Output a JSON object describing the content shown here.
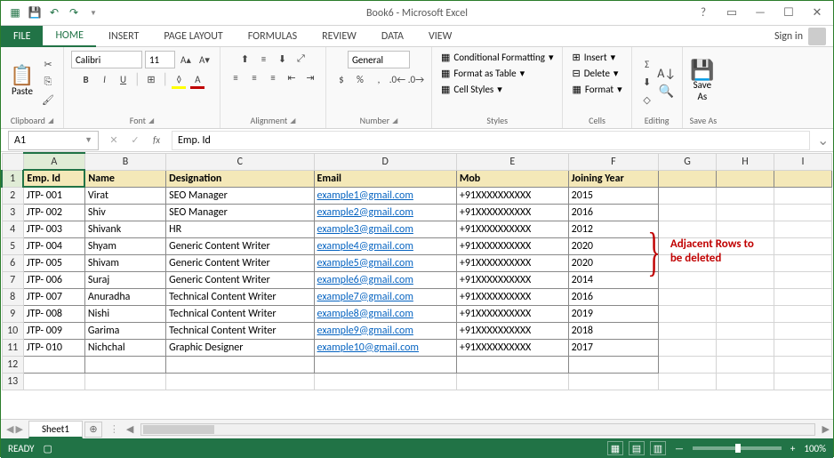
{
  "title": "Book6 - Microsoft Excel",
  "signin": "Sign in",
  "tabs": {
    "file": "FILE",
    "home": "HOME",
    "insert": "INSERT",
    "pagelayout": "PAGE LAYOUT",
    "formulas": "FORMULAS",
    "review": "REVIEW",
    "data": "DATA",
    "view": "VIEW"
  },
  "ribbon": {
    "clipboard": {
      "label": "Clipboard",
      "paste": "Paste"
    },
    "font": {
      "label": "Font",
      "name": "Calibri",
      "size": "11"
    },
    "alignment": {
      "label": "Alignment"
    },
    "number": {
      "label": "Number",
      "format": "General"
    },
    "styles": {
      "label": "Styles",
      "cf": "Conditional Formatting",
      "table": "Format as Table",
      "cell": "Cell Styles"
    },
    "cells": {
      "label": "Cells",
      "insert": "Insert",
      "delete": "Delete",
      "format": "Format"
    },
    "editing": {
      "label": "Editing"
    },
    "saveas": {
      "label": "Save As",
      "btn": "Save\nAs"
    }
  },
  "nameBox": "A1",
  "formulaValue": "Emp. Id",
  "columns": [
    "A",
    "B",
    "C",
    "D",
    "E",
    "F",
    "G",
    "H",
    "I"
  ],
  "headers": {
    "empid": "Emp. Id",
    "name": "Name",
    "designation": "Designation",
    "email": "Email",
    "mob": "Mob",
    "year": "Joining Year"
  },
  "chart_data": {
    "type": "table",
    "title": "Employee list",
    "columns": [
      "Emp. Id",
      "Name",
      "Designation",
      "Email",
      "Mob",
      "Joining Year"
    ],
    "rows": [
      [
        "JTP- 001",
        "Virat",
        "SEO Manager",
        "example1@gmail.com",
        "+91XXXXXXXXXX",
        2015
      ],
      [
        "JTP- 002",
        "Shiv",
        "SEO Manager",
        "example2@gmail.com",
        "+91XXXXXXXXXX",
        2016
      ],
      [
        "JTP- 003",
        "Shivank",
        "HR",
        "example3@gmail.com",
        "+91XXXXXXXXXX",
        2012
      ],
      [
        "JTP- 004",
        "Shyam",
        "Generic Content Writer",
        "example4@gmail.com",
        "+91XXXXXXXXXX",
        2020
      ],
      [
        "JTP- 005",
        "Shivam",
        "Generic Content Writer",
        "example5@gmail.com",
        "+91XXXXXXXXXX",
        2020
      ],
      [
        "JTP- 006",
        "Suraj",
        "Generic Content Writer",
        "example6@gmail.com",
        "+91XXXXXXXXXX",
        2014
      ],
      [
        "JTP- 007",
        "Anuradha",
        "Technical Content Writer",
        "example7@gmail.com",
        "+91XXXXXXXXXX",
        2016
      ],
      [
        "JTP- 008",
        "Nishi",
        "Technical Content Writer",
        "example8@gmail.com",
        "+91XXXXXXXXXX",
        2019
      ],
      [
        "JTP- 009",
        "Garima",
        "Technical Content Writer",
        "example9@gmail.com",
        "+91XXXXXXXXXX",
        2018
      ],
      [
        "JTP- 010",
        "Nichchal",
        "Graphic Designer",
        "example10@gmail.com",
        "+91XXXXXXXXXX",
        2017
      ]
    ]
  },
  "annotation": "Adjacent Rows to\nbe deleted",
  "sheetTab": "Sheet1",
  "status": {
    "ready": "READY",
    "zoom": "100%"
  }
}
